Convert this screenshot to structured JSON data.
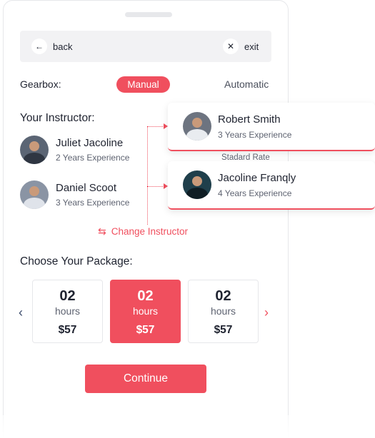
{
  "topbar": {
    "back_label": "back",
    "exit_label": "exit"
  },
  "gearbox": {
    "label": "Gearbox:",
    "options": [
      "Manual",
      "Automatic"
    ],
    "selected": "Manual"
  },
  "instructors_section": {
    "title": "Your Instructor:",
    "items": [
      {
        "name": "Juliet Jacoline",
        "experience": "2 Years Experience"
      },
      {
        "name": "Daniel Scoot",
        "experience": "3 Years Experience"
      }
    ],
    "change_label": "Change Instructor"
  },
  "popup_cards": [
    {
      "name": "Robert Smith",
      "experience": "3 Years Experience"
    },
    {
      "name": "Jacoline Franqly",
      "experience": "4 Years Experience"
    }
  ],
  "rate_label": "Stadard Rate",
  "packages_section": {
    "title": "Choose Your Package:",
    "items": [
      {
        "amount": "02",
        "unit": "hours",
        "price": "$57",
        "selected": false
      },
      {
        "amount": "02",
        "unit": "hours",
        "price": "$57",
        "selected": true
      },
      {
        "amount": "02",
        "unit": "hours",
        "price": "$57",
        "selected": false
      }
    ]
  },
  "continue_label": "Continue",
  "icons": {
    "back": "arrow-left-icon",
    "exit": "close-icon",
    "change": "swap-arrows-icon",
    "prev": "chevron-left-icon",
    "next": "chevron-right-icon"
  },
  "colors": {
    "accent": "#f04f5e",
    "text": "#1f2330",
    "muted": "#5e6371",
    "topbar_bg": "#f2f2f4"
  }
}
